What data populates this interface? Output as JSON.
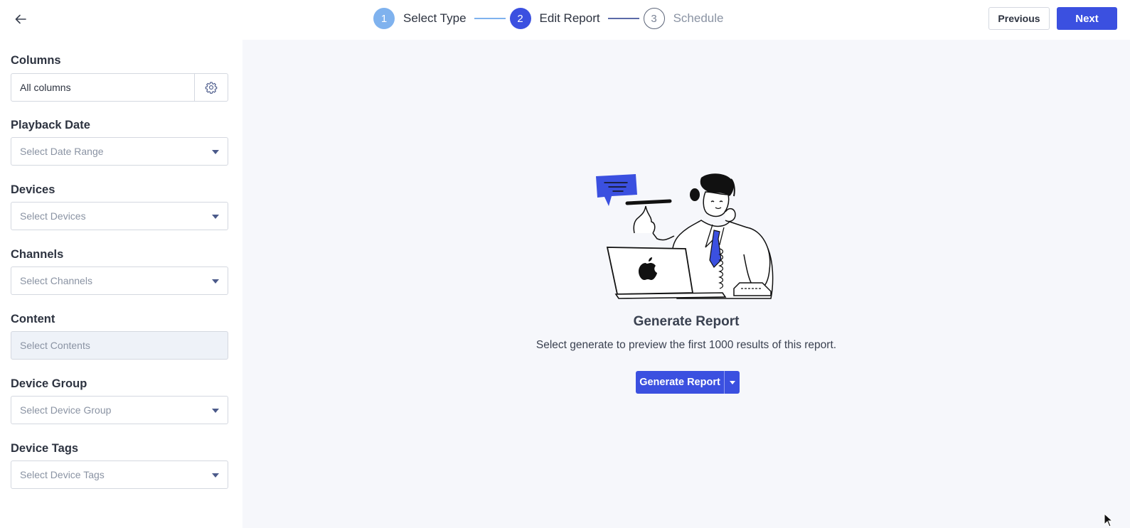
{
  "header": {
    "steps": [
      {
        "number": "1",
        "label": "Select Type"
      },
      {
        "number": "2",
        "label": "Edit Report"
      },
      {
        "number": "3",
        "label": "Schedule"
      }
    ],
    "previous_label": "Previous",
    "next_label": "Next"
  },
  "sidebar": {
    "columns": {
      "label": "Columns",
      "value": "All columns"
    },
    "playback_date": {
      "label": "Playback Date",
      "placeholder": "Select Date Range"
    },
    "devices": {
      "label": "Devices",
      "placeholder": "Select Devices"
    },
    "channels": {
      "label": "Channels",
      "placeholder": "Select Channels"
    },
    "content": {
      "label": "Content",
      "placeholder": "Select Contents"
    },
    "device_group": {
      "label": "Device Group",
      "placeholder": "Select Device Group"
    },
    "device_tags": {
      "label": "Device Tags",
      "placeholder": "Select Device Tags"
    }
  },
  "main": {
    "title": "Generate Report",
    "subtitle": "Select generate to preview the first 1000 results of this report.",
    "generate_label": "Generate Report"
  },
  "colors": {
    "primary": "#3b50e0",
    "step_done": "#7fb2ee",
    "background": "#f6f7fb"
  }
}
